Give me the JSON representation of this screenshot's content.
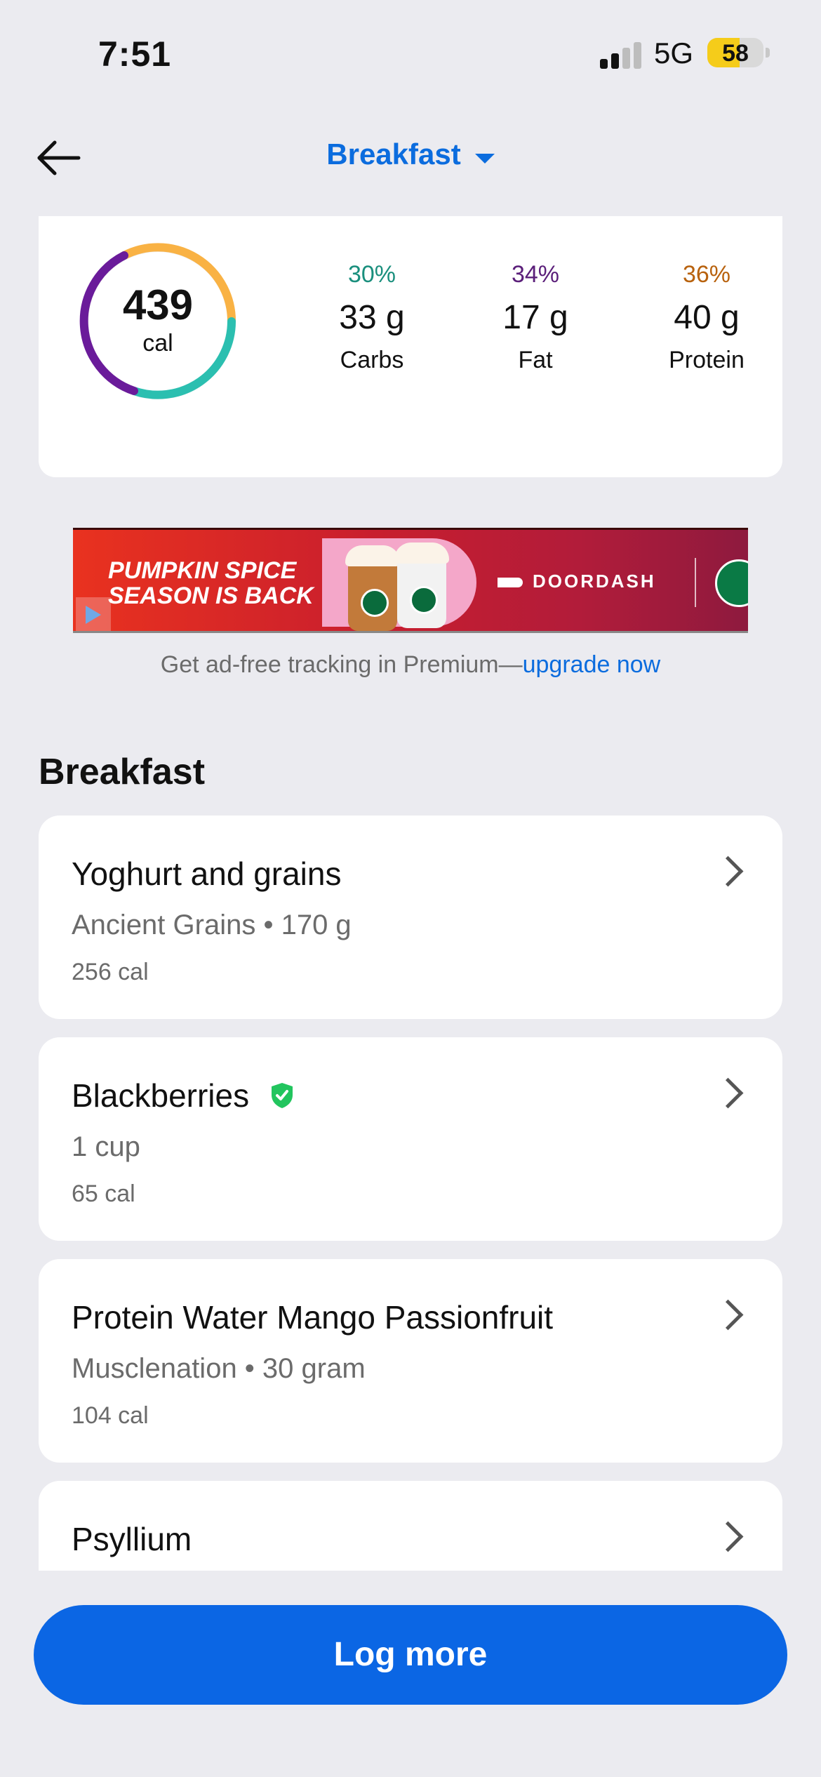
{
  "status_bar": {
    "time": "7:51",
    "network": "5G",
    "battery": "58",
    "battery_level": 0.58
  },
  "header": {
    "title": "Breakfast"
  },
  "summary": {
    "calories": "439",
    "calories_unit": "cal",
    "macros": [
      {
        "pct": "30%",
        "grams": "33 g",
        "name": "Carbs",
        "color": "#1a8f7d"
      },
      {
        "pct": "34%",
        "grams": "17 g",
        "name": "Fat",
        "color": "#5b1f7a"
      },
      {
        "pct": "36%",
        "grams": "40 g",
        "name": "Protein",
        "color": "#b8620e"
      }
    ],
    "ring_colors": {
      "carbs": "#2bbfb0",
      "fat": "#6a1b9a",
      "protein": "#f9b244"
    }
  },
  "ad": {
    "headline_line1": "PUMPKIN SPICE",
    "headline_line2": "SEASON IS BACK",
    "brand": "DOORDASH",
    "note": "Get ad-free tracking in Premium—",
    "note_link": "upgrade now"
  },
  "section": {
    "title": "Breakfast"
  },
  "foods": [
    {
      "name": "Yoghurt and grains",
      "detail": "Ancient Grains • 170 g",
      "calories": "256 cal",
      "verified": false
    },
    {
      "name": "Blackberries",
      "detail": "1 cup",
      "calories": "65 cal",
      "verified": true
    },
    {
      "name": "Protein Water Mango Passionfruit",
      "detail": "Musclenation • 30 gram",
      "calories": "104 cal",
      "verified": false
    },
    {
      "name": "Psyllium",
      "detail": "",
      "calories": "",
      "verified": false
    }
  ],
  "actions": {
    "log_more": "Log more"
  },
  "colors": {
    "accent": "#0b66e4",
    "background": "#ebebf0",
    "verified": "#22c55e"
  }
}
